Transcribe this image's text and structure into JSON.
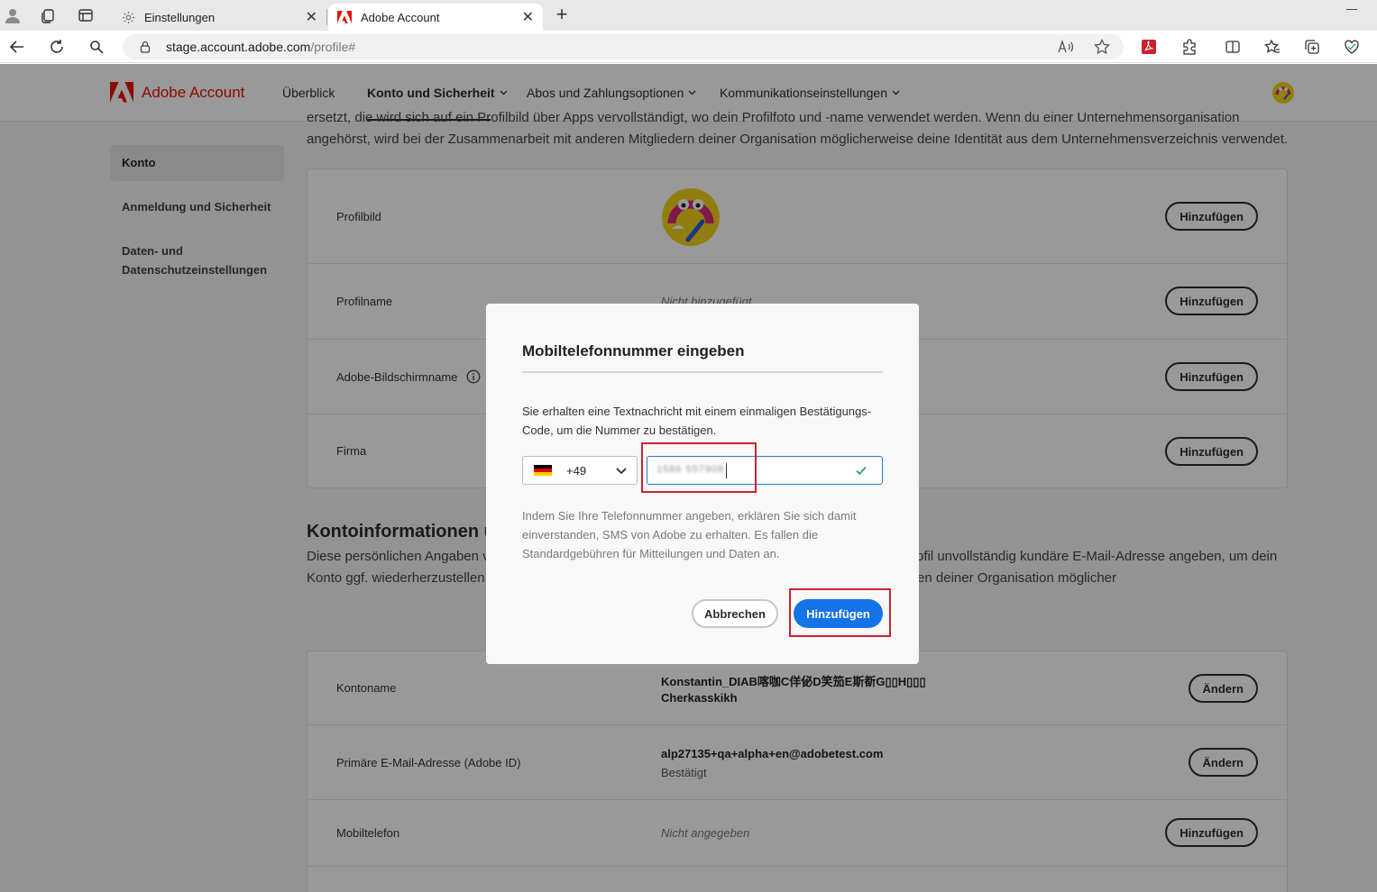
{
  "browser": {
    "tabs": [
      {
        "label": "Einstellungen",
        "icon": "gear-icon",
        "active": false
      },
      {
        "label": "Adobe Account",
        "icon": "adobe-icon",
        "active": true
      }
    ],
    "url_host": "stage.account.adobe.com",
    "url_path": "/profile#"
  },
  "header": {
    "brand": "Adobe Account",
    "nav": [
      {
        "label": "Überblick",
        "has_menu": false
      },
      {
        "label": "Konto und Sicherheit",
        "has_menu": true
      },
      {
        "label": "Abos und Zahlungsoptionen",
        "has_menu": true
      },
      {
        "label": "Kommunikationseinstellungen",
        "has_menu": true
      }
    ],
    "chevron": "⌵"
  },
  "sidebar": {
    "items": [
      "Konto",
      "Anmeldung und Sicherheit",
      "Daten- und Datenschutzeinstellungen"
    ]
  },
  "intro_text": "ersetzt, die wird sich auf ein Profilbild über Apps vervollständigt, wo dein Profilfoto und -name verwendet werden. Wenn du einer Unternehmensorganisation angehörst, wird bei der Zusammenarbeit mit anderen Mitgliedern deiner Organisation möglicherweise deine Identität aus dem Unternehmensverzeichnis verwendet.",
  "profile_card": {
    "rows": [
      {
        "label": "Profilbild",
        "value": "",
        "button": "Hinzufügen"
      },
      {
        "label": "Profilname",
        "value": "Nicht hinzugefügt",
        "button": "Hinzufügen"
      },
      {
        "label": "Adobe-Bildschirmname",
        "value": "",
        "button": "Hinzufügen"
      },
      {
        "label": "Firma",
        "value": "",
        "button": "Hinzufügen"
      }
    ]
  },
  "account_section": {
    "title": "Kontoinformationen un",
    "text": "Diese persönlichen Angaben ve                                                                                                         werden bei der Zusammenarbeit angezeigt, wenn dein öffentliches Profil unvollständig                                                                                                 kundäre E-Mail-Adresse angeben, um dein Konto ggf. wiederherzustellen und Benach                                                                                               hörst, wird bei der Zusammenarbeit mit anderen Angehörigen deiner Organisation möglicher"
  },
  "account_card": {
    "rows": [
      {
        "label": "Kontoname",
        "value_line1": "Konstantin_DIAB喀咖C佯佖D笑笳E斯斱G▯▯H▯▯▯",
        "value_line2": "Cherkasskikh",
        "button": "Ändern"
      },
      {
        "label": "Primäre E-Mail-Adresse (Adobe ID)",
        "value_line1": "alp27135+qa+alpha+en@adobetest.com",
        "value_line2": "Bestätigt",
        "button": "Ändern"
      },
      {
        "label": "Mobiltelefon",
        "value_line1": "Nicht angegeben",
        "value_line2": "",
        "button": "Hinzufügen"
      }
    ]
  },
  "dialog": {
    "title": "Mobiltelefonnummer eingeben",
    "description": "Sie erhalten eine Textnachricht mit einem einmaligen Bestätigungs-Code, um die Nummer zu bestätigen.",
    "country": {
      "flag": "germany-flag",
      "dial_code": "+49"
    },
    "phone_value": "1586 557908",
    "note": "Indem Sie Ihre Telefonnummer angeben, erklären Sie sich damit einverstanden, SMS von Adobe zu erhalten. Es fallen die Standardgebühren für Mitteilungen und Daten an.",
    "cancel_label": "Abbrechen",
    "confirm_label": "Hinzufügen"
  },
  "colors": {
    "adobe_red": "#eb1000",
    "primary_blue": "#1473e6",
    "highlight_red": "#c8242f",
    "valid_green": "#2d9d78"
  }
}
